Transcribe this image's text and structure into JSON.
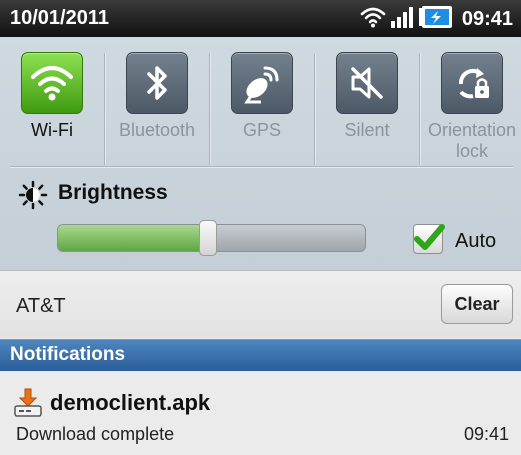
{
  "status_bar": {
    "date": "10/01/2011",
    "time": "09:41",
    "icons": [
      "wifi-signal-icon",
      "cell-signal-icon",
      "battery-charging-icon"
    ]
  },
  "quick_settings": {
    "toggles": [
      {
        "label": "Wi-Fi",
        "icon": "wifi-icon",
        "enabled": true
      },
      {
        "label": "Bluetooth",
        "icon": "bluetooth-icon",
        "enabled": false
      },
      {
        "label": "GPS",
        "icon": "gps-icon",
        "enabled": false
      },
      {
        "label": "Silent",
        "icon": "silent-icon",
        "enabled": false
      },
      {
        "label_line1": "Orientation",
        "label_line2": "lock",
        "icon": "orientation-lock-icon",
        "enabled": false
      }
    ],
    "brightness": {
      "title": "Brightness",
      "level": 0.49,
      "auto_label": "Auto",
      "auto_checked": true
    }
  },
  "carrier": {
    "name": "AT&T",
    "clear_label": "Clear"
  },
  "notifications": {
    "header": "Notifications",
    "items": [
      {
        "title": "democlient.apk",
        "subtitle": "Download complete",
        "time": "09:41",
        "icon": "download-icon"
      }
    ]
  },
  "colors": {
    "toggle_on": "#5cb82a",
    "header_blue": "#3a70ad",
    "slider_fill": "#7cc05c"
  }
}
